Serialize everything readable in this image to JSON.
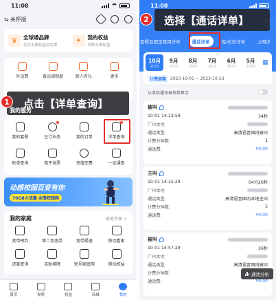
{
  "left": {
    "status": {
      "time": "11:08"
    },
    "topbar": {
      "care_label": "关怀版"
    },
    "rights": [
      {
        "icon": "crown-icon",
        "title": "全球通品牌",
        "sub": "享受专属权益及优惠"
      },
      {
        "icon": "gift-icon",
        "title": "我的权益",
        "sub": "领取专属权益"
      }
    ],
    "badge_count": "",
    "top_grid": [
      "补话费",
      "备话调制度",
      "新人有礼",
      "更多"
    ],
    "callout1": {
      "num": "1",
      "text": "点击【详单查询】"
    },
    "services": {
      "title": "我的服务",
      "row1": [
        "我的套餐",
        "已订业务",
        "我的订单",
        "详单查询"
      ],
      "row2": [
        "账单查询",
        "电子发票",
        "充值交费",
        "一证通查"
      ]
    },
    "banner": {
      "title": "动感校园百变有你",
      "sub": "70GB大流量 余情校园网"
    },
    "family": {
      "title": "我的家庭",
      "more": "家庭专享 >",
      "row1": [
        "宽带预约",
        "第二条宽带",
        "宽带提速",
        "移动看家"
      ],
      "row2": [
        "进度查询",
        "自助排障",
        "短号家庭网",
        "移动权益"
      ]
    },
    "tabbar": [
      "首页",
      "探索",
      "权益",
      "商城",
      "我的"
    ]
  },
  "right": {
    "status": {
      "time": "11:08"
    },
    "callout2": {
      "num": "2",
      "text": "选择【通话详单】"
    },
    "tabs": [
      "套餐及固定费用详单",
      "通话详单",
      "短/彩信详单",
      "上网详"
    ],
    "months": [
      {
        "m": "10月",
        "y": "2023"
      },
      {
        "m": "9月",
        "y": "2023"
      },
      {
        "m": "8月",
        "y": "2023"
      },
      {
        "m": "7月",
        "y": "2023"
      },
      {
        "m": "6月",
        "y": "2023"
      },
      {
        "m": "5月",
        "y": "2023"
      }
    ],
    "period": {
      "label": "计费周期",
      "value": "2023-10-01 ~ 2023-10-23"
    },
    "show_name": "以本机通讯录名称显示",
    "records": [
      {
        "type": "被叫",
        "time": "10-01 14:13:59",
        "duration": "34秒",
        "place": "广州本地",
        "k1": "通话类型:",
        "v1": "高清语音国内被叫",
        "k2": "计费分钟数:",
        "v2": "1",
        "k3": "通话费:",
        "v3": "¥0.00"
      },
      {
        "type": "主叫",
        "time": "10-01 14:15:29",
        "duration": "04分26秒",
        "place": "广州本地",
        "k1": "通话类型:",
        "v1": "高清语音国内本地主叫",
        "k2": "计费分钟数:",
        "v2": "5",
        "k3": "通话费:",
        "v3": "¥0.00"
      },
      {
        "type": "被叫",
        "time": "10-01 14:57:29",
        "duration": "36秒",
        "place": "广州本地",
        "k1": "通话类型:",
        "v1": "高清语音国内被叫",
        "k2": "计费分钟数:",
        "v2": "",
        "k3": "通话费:",
        "v3": "¥0.00"
      }
    ],
    "float_btn": "通话分析"
  }
}
